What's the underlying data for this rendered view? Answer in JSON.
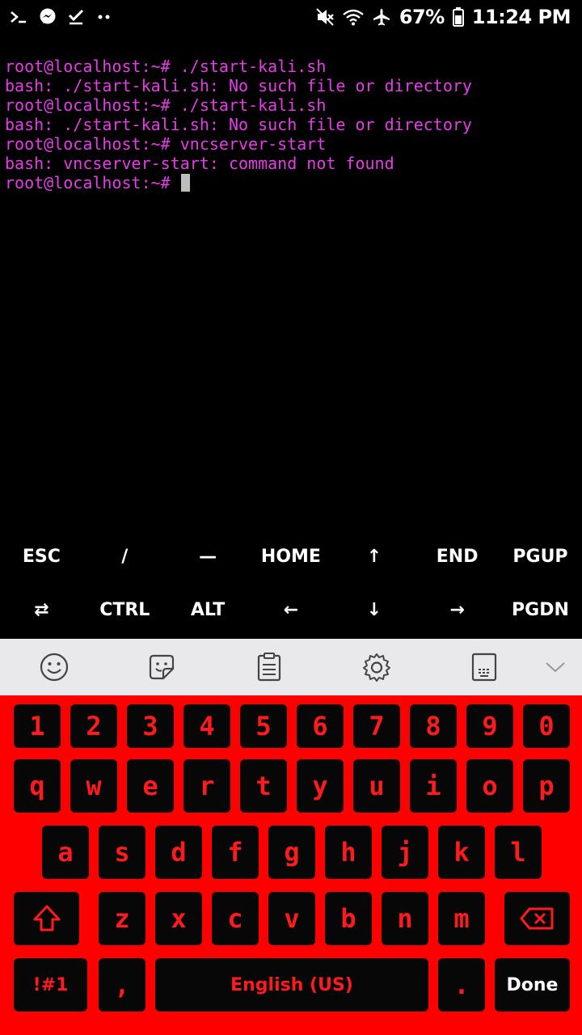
{
  "status_bar": {
    "battery": "67%",
    "time": "11:24 PM",
    "left_icons": [
      "terminal-icon",
      "messenger-icon",
      "check-icon",
      "more-dots-icon"
    ],
    "right_icons": [
      "mute-icon",
      "wifi-icon",
      "airplane-icon",
      "battery-icon"
    ]
  },
  "terminal": {
    "lines": [
      "root@localhost:~# ./start-kali.sh",
      "bash: ./start-kali.sh: No such file or directory",
      "root@localhost:~# ./start-kali.sh",
      "bash: ./start-kali.sh: No such file or directory",
      "root@localhost:~# vncserver-start",
      "bash: vncserver-start: command not found",
      "root@localhost:~# "
    ],
    "text_color": "#e83ce8"
  },
  "extra_keys": {
    "row1": [
      "ESC",
      "/",
      "—",
      "HOME",
      "↑",
      "END",
      "PGUP"
    ],
    "row2": [
      "⇄",
      "CTRL",
      "ALT",
      "←",
      "↓",
      "→",
      "PGDN"
    ]
  },
  "toolbar": {
    "icons": [
      "emoji-icon",
      "sticker-icon",
      "clipboard-icon",
      "settings-icon",
      "keyboard-mode-icon",
      "collapse-chevron-icon"
    ]
  },
  "keyboard": {
    "accent": "#ff0000",
    "number_row": [
      "1",
      "2",
      "3",
      "4",
      "5",
      "6",
      "7",
      "8",
      "9",
      "0"
    ],
    "row_q": [
      "q",
      "w",
      "e",
      "r",
      "t",
      "y",
      "u",
      "i",
      "o",
      "p"
    ],
    "row_a": [
      "a",
      "s",
      "d",
      "f",
      "g",
      "h",
      "j",
      "k",
      "l"
    ],
    "row_z": [
      "z",
      "x",
      "c",
      "v",
      "b",
      "n",
      "m"
    ],
    "symbols_key": "!#1",
    "comma_key": ",",
    "space_label": "English (US)",
    "period_key": ".",
    "done_key": "Done"
  }
}
